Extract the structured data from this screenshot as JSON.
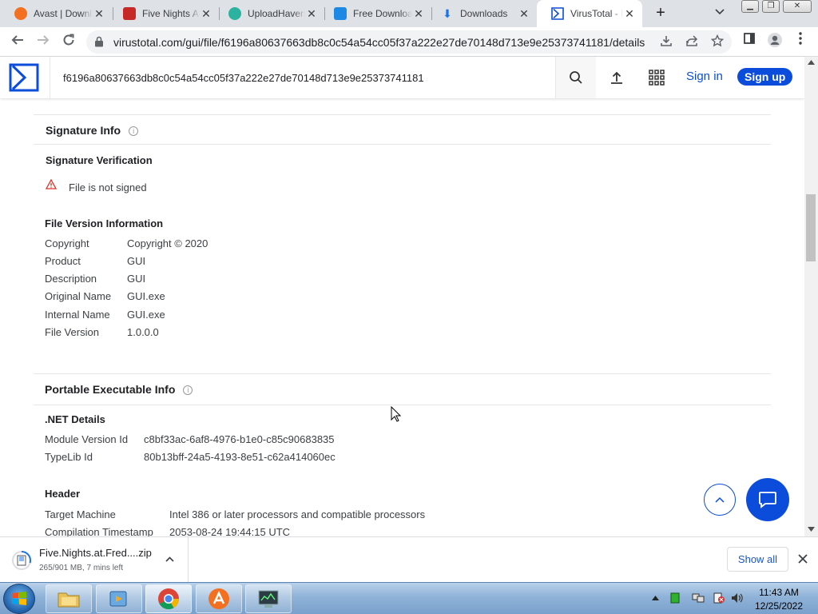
{
  "browser": {
    "tabs": [
      {
        "title": "Avast | Download Free",
        "icon": "avast-icon",
        "active": false
      },
      {
        "title": "Five Nights At Freddy's",
        "icon": "five-nights-icon",
        "active": false
      },
      {
        "title": "UploadHaven",
        "icon": "uploadhaven-icon",
        "active": false
      },
      {
        "title": "Free Download",
        "icon": "free-download-icon",
        "active": false
      },
      {
        "title": "Downloads",
        "icon": "download-icon",
        "active": false
      },
      {
        "title": "VirusTotal - File",
        "icon": "virustotal-icon",
        "active": true
      }
    ],
    "url": "virustotal.com/gui/file/f6196a80637663db8c0c54a54cc05f37a222e27de70148d713e9e25373741181/details"
  },
  "header": {
    "search_value": "f6196a80637663db8c0c54a54cc05f37a222e27de70148d713e9e25373741181",
    "sign_in": "Sign in",
    "sign_up": "Sign up"
  },
  "signature": {
    "title": "Signature Info",
    "verification_title": "Signature Verification",
    "verification_status": "File is not signed",
    "version_title": "File Version Information",
    "rows": [
      {
        "label": "Copyright",
        "value": "Copyright © 2020"
      },
      {
        "label": "Product",
        "value": "GUI"
      },
      {
        "label": "Description",
        "value": "GUI"
      },
      {
        "label": "Original Name",
        "value": "GUI.exe"
      },
      {
        "label": "Internal Name",
        "value": "GUI.exe"
      },
      {
        "label": "File Version",
        "value": "1.0.0.0"
      }
    ]
  },
  "pe": {
    "title": "Portable Executable Info",
    "net_title": ".NET Details",
    "net_rows": [
      {
        "label": "Module Version Id",
        "value": "c8bf33ac-6af8-4976-b1e0-c85c90683835"
      },
      {
        "label": "TypeLib Id",
        "value": "80b13bff-24a5-4193-8e51-c62a414060ec"
      }
    ],
    "header_title": "Header",
    "header_rows": [
      {
        "label": "Target Machine",
        "value": "Intel 386 or later processors and compatible processors"
      },
      {
        "label": "Compilation Timestamp",
        "value": "2053-08-24 19:44:15 UTC"
      }
    ]
  },
  "download": {
    "filename": "Five.Nights.at.Fred....zip",
    "status": "265/901 MB, 7 mins left",
    "progress": 0.294,
    "show_all": "Show all"
  },
  "taskbar": {
    "time": "11:43 AM",
    "date": "12/25/2022"
  },
  "colors": {
    "vt_blue": "#0b4dda",
    "warning_red": "#d93025"
  }
}
